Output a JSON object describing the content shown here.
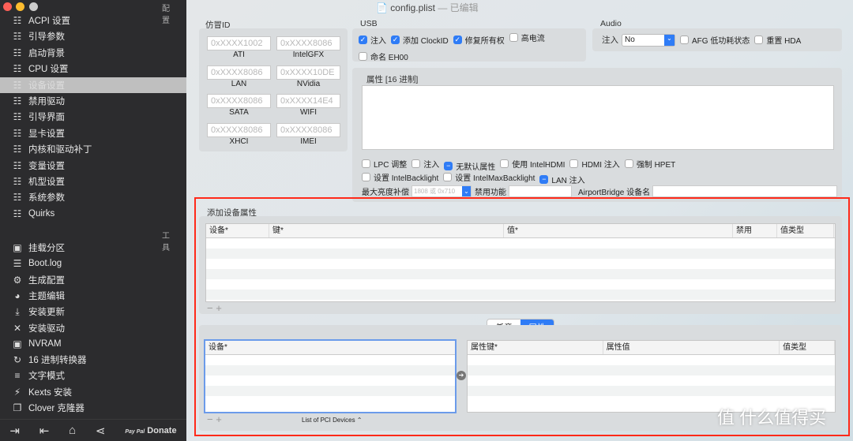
{
  "window": {
    "title": "config.plist",
    "status": "— 已编辑"
  },
  "sidebar": {
    "config_header": "配 置",
    "config_items": [
      {
        "label": "ACPI 设置",
        "icon": "list-icon"
      },
      {
        "label": "引导参数",
        "icon": "list-icon"
      },
      {
        "label": "启动背景",
        "icon": "list-icon"
      },
      {
        "label": "CPU 设置",
        "icon": "list-icon"
      },
      {
        "label": "设备设置",
        "icon": "list-icon",
        "selected": true
      },
      {
        "label": "禁用驱动",
        "icon": "list-icon"
      },
      {
        "label": "引导界面",
        "icon": "list-icon"
      },
      {
        "label": "显卡设置",
        "icon": "list-icon"
      },
      {
        "label": "内核和驱动补丁",
        "icon": "list-icon"
      },
      {
        "label": "变量设置",
        "icon": "list-icon"
      },
      {
        "label": "机型设置",
        "icon": "list-icon"
      },
      {
        "label": "系统参数",
        "icon": "list-icon"
      },
      {
        "label": "Quirks",
        "icon": "list-icon"
      }
    ],
    "tools_header": "工 具",
    "tool_items": [
      {
        "label": "挂载分区",
        "icon": "disk-icon"
      },
      {
        "label": "Boot.log",
        "icon": "log-icon"
      },
      {
        "label": "生成配置",
        "icon": "gears-icon"
      },
      {
        "label": "主题编辑",
        "icon": "palette-icon"
      },
      {
        "label": "安装更新",
        "icon": "download-icon"
      },
      {
        "label": "安装驱动",
        "icon": "tools-icon"
      },
      {
        "label": "NVRAM",
        "icon": "chip-icon"
      },
      {
        "label": "16 进制转换器",
        "icon": "refresh-icon"
      },
      {
        "label": "文字模式",
        "icon": "text-icon"
      },
      {
        "label": "Kexts 安装",
        "icon": "plug-icon"
      },
      {
        "label": "Clover 克隆器",
        "icon": "clone-icon"
      }
    ],
    "bottom": {
      "paypal": "Pay Pal",
      "donate": "Donate"
    }
  },
  "fake_id": {
    "title": "仿冒ID",
    "fields": [
      {
        "placeholder": "0xXXXX1002",
        "label": "ATI"
      },
      {
        "placeholder": "0xXXXX8086",
        "label": "IntelGFX"
      },
      {
        "placeholder": "0xXXXX8086",
        "label": "LAN"
      },
      {
        "placeholder": "0xXXXX10DE",
        "label": "NVidia"
      },
      {
        "placeholder": "0xXXXX8086",
        "label": "SATA"
      },
      {
        "placeholder": "0xXXXX14E4",
        "label": "WIFI"
      },
      {
        "placeholder": "0xXXXX8086",
        "label": "XHCI"
      },
      {
        "placeholder": "0xXXXX8086",
        "label": "IMEI"
      }
    ]
  },
  "usb": {
    "title": "USB",
    "options": [
      {
        "label": "注入",
        "checked": true
      },
      {
        "label": "添加 ClockID",
        "checked": true
      },
      {
        "label": "修复所有权",
        "checked": true
      },
      {
        "label": "高电流",
        "checked": false
      },
      {
        "label": "命名 EH00",
        "checked": false
      }
    ]
  },
  "audio": {
    "title": "Audio",
    "inject_label": "注入",
    "inject_value": "No",
    "options": [
      {
        "label": "AFG 低功耗状态",
        "checked": false
      },
      {
        "label": "重置 HDA",
        "checked": false
      }
    ]
  },
  "properties": {
    "title": "属性 [16 进制]",
    "row1": [
      {
        "label": "LPC 调整",
        "state": "off"
      },
      {
        "label": "注入",
        "state": "off"
      },
      {
        "label": "无默认属性",
        "state": "mixed"
      },
      {
        "label": "使用 IntelHDMI",
        "state": "off"
      },
      {
        "label": "HDMI 注入",
        "state": "off"
      },
      {
        "label": "强制 HPET",
        "state": "off"
      }
    ],
    "row2": [
      {
        "label": "设置 IntelBacklight",
        "state": "off"
      },
      {
        "label": "设置 IntelMaxBacklight",
        "state": "off"
      },
      {
        "label": "LAN 注入",
        "state": "mixed"
      }
    ],
    "max_brightness_label": "最大亮度补偿",
    "max_brightness_placeholder": "1808 或 0x710",
    "disable_label": "禁用功能",
    "airport_label": "AirportBridge 设备名"
  },
  "add_props": {
    "title": "添加设备属性",
    "columns": [
      "设备*",
      "键*",
      "值*",
      "禁用",
      "值类型"
    ]
  },
  "segment": {
    "options": [
      "任意",
      "属性"
    ],
    "selected": "属性"
  },
  "devices": {
    "columns": [
      "设备*"
    ],
    "popup": "List of PCI Devices"
  },
  "prop_table": {
    "columns": [
      "属性键*",
      "属性值",
      "值类型"
    ]
  },
  "watermark": "值 什么值得买",
  "colors": {
    "accent": "#2f7cf6",
    "highlight": "#ff2a1a",
    "sidebar": "#2c2c2e"
  }
}
